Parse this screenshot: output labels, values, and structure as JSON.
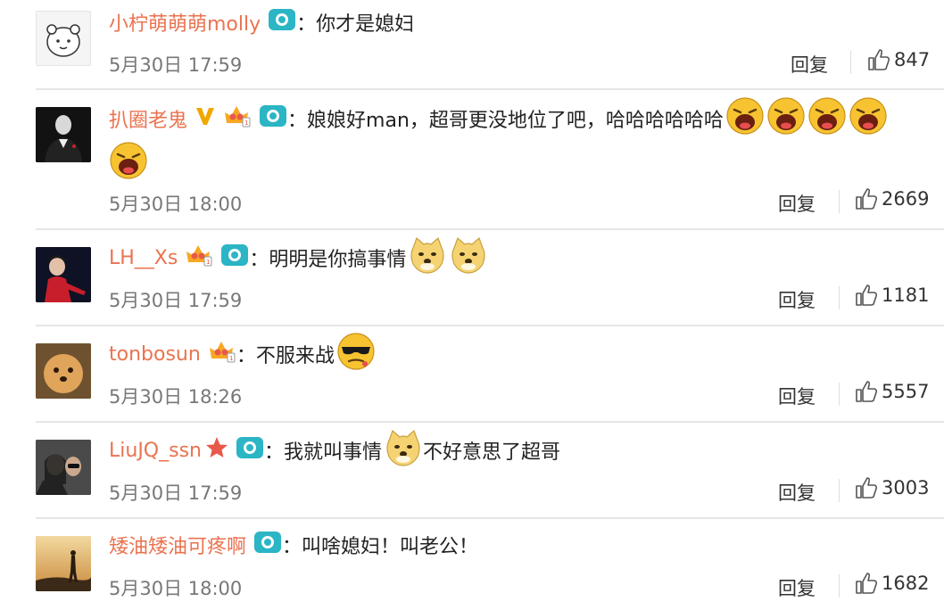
{
  "comments": [
    {
      "username": "小柠萌萌萌molly",
      "text": "你才是媳妇",
      "time": "5月30日 17:59",
      "reply": "回复",
      "likes": "847",
      "badges": [
        "camera-icon"
      ],
      "emojis": []
    },
    {
      "username": "扒圈老鬼",
      "text": "娘娘好man，超哥更没地位了吧，哈哈哈哈哈哈",
      "time": "5月30日 18:00",
      "reply": "回复",
      "likes": "2669",
      "badges": [
        "verified-v-icon",
        "member-crown-icon",
        "camera-icon"
      ],
      "emojis": [
        "laugh-emoji",
        "laugh-emoji",
        "laugh-emoji",
        "laugh-emoji",
        "laugh-emoji"
      ]
    },
    {
      "username": "LH__Xs",
      "text": "明明是你搞事情",
      "time": "5月30日 17:59",
      "reply": "回复",
      "likes": "1181",
      "badges": [
        "member-crown-icon",
        "camera-icon"
      ],
      "emojis": [
        "doge-emoji",
        "doge-emoji"
      ]
    },
    {
      "username": "tonbosun",
      "text": "不服来战",
      "time": "5月30日 18:26",
      "reply": "回复",
      "likes": "5557",
      "badges": [
        "member-crown-icon"
      ],
      "emojis": [
        "cool-emoji"
      ]
    },
    {
      "username": "LiuJQ_ssn",
      "text": "我就叫事情",
      "text2": "不好意思了超哥",
      "time": "5月30日 17:59",
      "reply": "回复",
      "likes": "3003",
      "badges": [
        "star-icon",
        "camera-icon"
      ],
      "emojis": [
        "doge-emoji"
      ]
    },
    {
      "username": "矮油矮油可疼啊",
      "text": "叫啥媳妇！叫老公！",
      "time": "5月30日 18:00",
      "reply": "回复",
      "likes": "1682",
      "badges": [
        "camera-icon"
      ],
      "emojis": []
    }
  ],
  "colon": "：",
  "colors": {
    "username": "#eb7350",
    "camera_badge": "#2bb5c5",
    "verified": "#f0a800",
    "crown": "#e8594b",
    "star": "#e8594b",
    "emoji_yellow": "#f7c331"
  }
}
